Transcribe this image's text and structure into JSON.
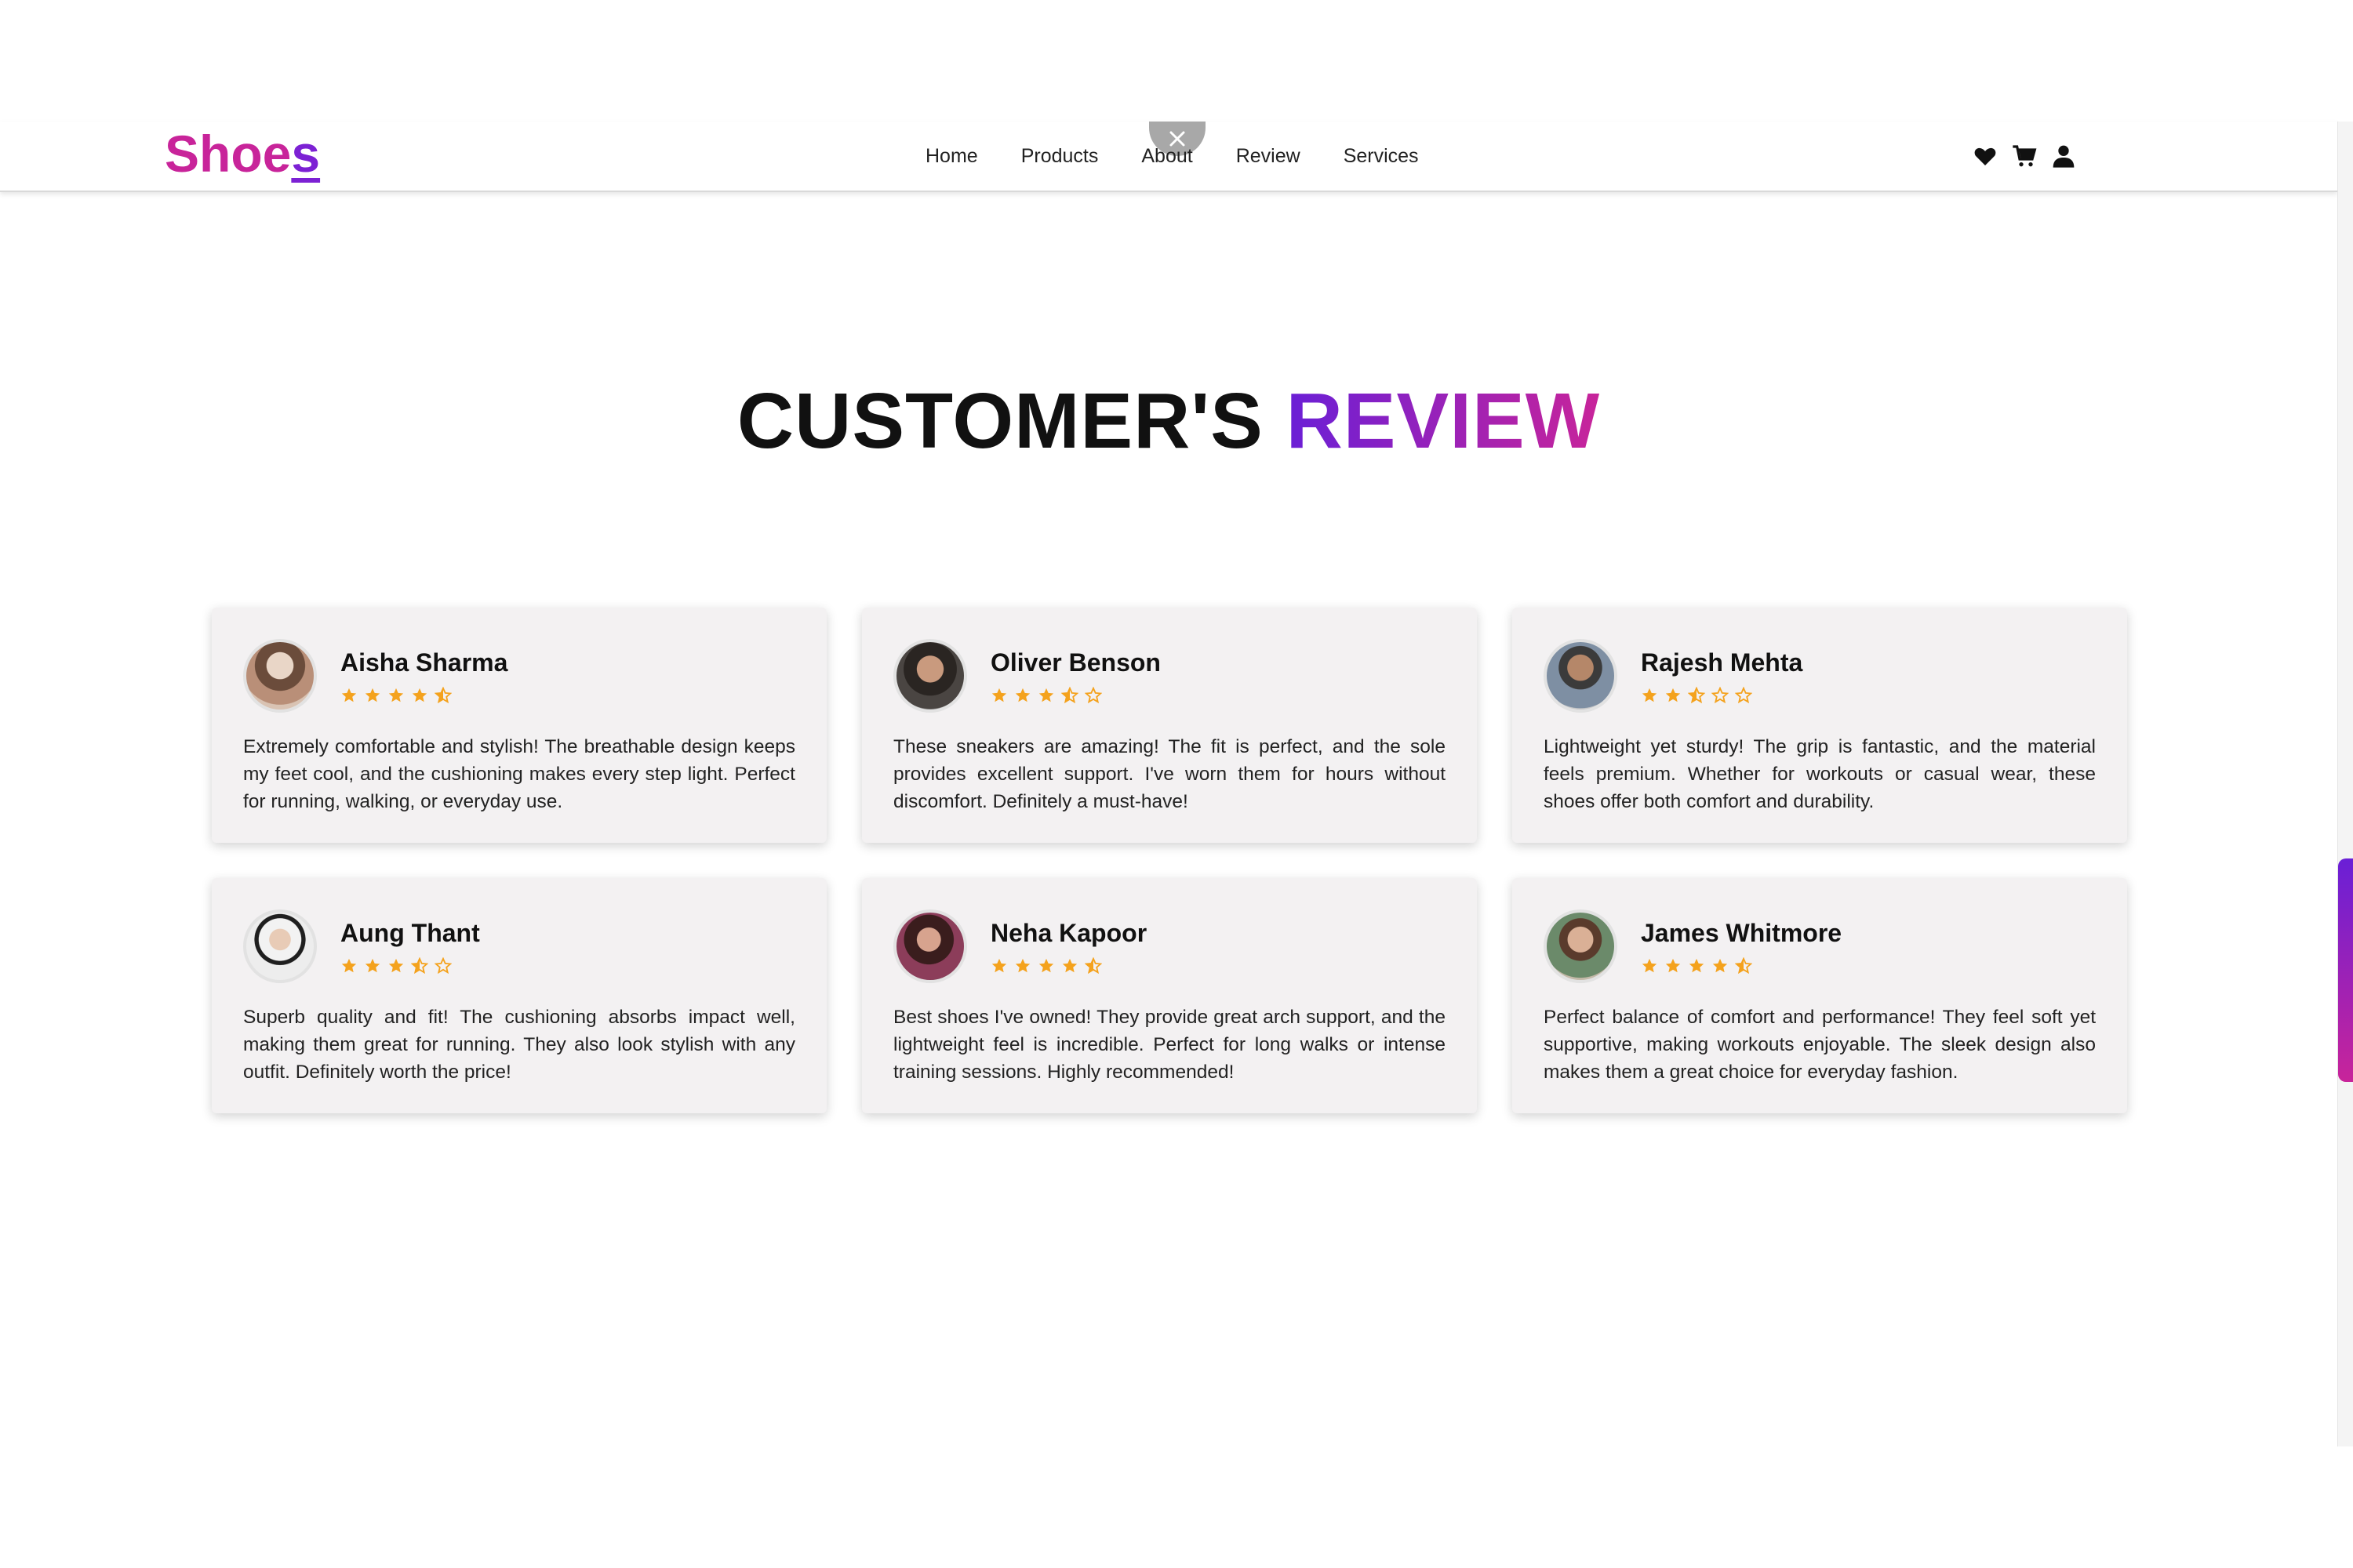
{
  "header": {
    "logo_main": "Shoe",
    "logo_last": "s",
    "nav": [
      "Home",
      "Products",
      "About",
      "Review",
      "Services"
    ],
    "icons": [
      "heart-icon",
      "cart-icon",
      "user-icon"
    ],
    "close_icon": "close-icon"
  },
  "section": {
    "title_plain": "CUSTOMER'S",
    "title_accent": "REVIEW"
  },
  "colors": {
    "brand_pink": "#c8249a",
    "brand_purple": "#6a1fd6",
    "star": "#f4a21d",
    "card_bg": "#f3f1f2"
  },
  "reviews": [
    {
      "name": "Aisha Sharma",
      "rating": 4.5,
      "text": "Extremely comfortable and stylish! The breathable design keeps my feet cool, and the cushioning makes every step light. Perfect for running, walking, or everyday use."
    },
    {
      "name": "Oliver Benson",
      "rating": 3.5,
      "text": "These sneakers are amazing! The fit is perfect, and the sole provides excellent support. I've worn them for hours without discomfort. Definitely a must-have!"
    },
    {
      "name": "Rajesh Mehta",
      "rating": 2.5,
      "text": "Lightweight yet sturdy! The grip is fantastic, and the material feels premium. Whether for workouts or casual wear, these shoes offer both comfort and durability."
    },
    {
      "name": "Aung Thant",
      "rating": 3.5,
      "text": "Superb quality and fit! The cushioning absorbs impact well, making them great for running. They also look stylish with any outfit. Definitely worth the price!"
    },
    {
      "name": "Neha Kapoor",
      "rating": 4.5,
      "text": "Best shoes I've owned! They provide great arch support, and the lightweight feel is incredible. Perfect for long walks or intense training sessions. Highly recommended!"
    },
    {
      "name": "James Whitmore",
      "rating": 4.5,
      "text": "Perfect balance of comfort and performance! They feel soft yet supportive, making workouts enjoyable. The sleek design also makes them a great choice for everyday fashion."
    }
  ]
}
